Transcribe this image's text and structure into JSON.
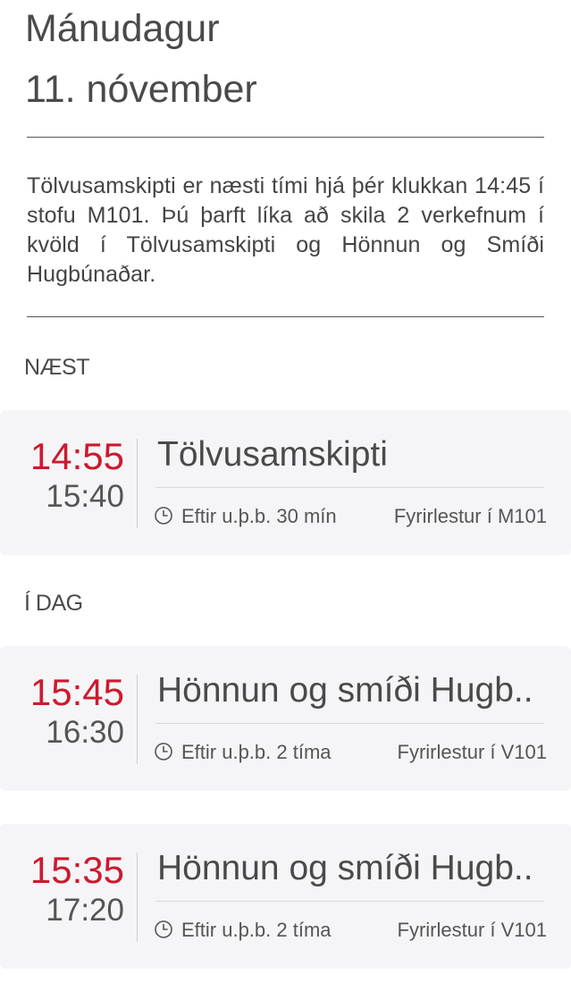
{
  "header": {
    "weekday": "Mánudagur",
    "date": "11. nóvember"
  },
  "summary": "Tölvusamskipti er næsti tími hjá þér klukkan 14:45 í stofu M101. Þú þarft líka að skila 2 verkefnum í kvöld í Tölvusamskipti og Hönnun og Smíði Hugbúnaðar.",
  "sections": {
    "next_label": "NÆST",
    "today_label": "Í DAG"
  },
  "next": [
    {
      "start": "14:55",
      "end": "15:40",
      "title": "Tölvusamskipti",
      "eta": "Eftir u.þ.b. 30 mín",
      "place": "Fyrirlestur í M101"
    }
  ],
  "today": [
    {
      "start": "15:45",
      "end": "16:30",
      "title": "Hönnun og smíði Hugb..",
      "eta": "Eftir u.þ.b. 2 tíma",
      "place": "Fyrirlestur í V101"
    },
    {
      "start": "15:35",
      "end": "17:20",
      "title": "Hönnun og smíði Hugb..",
      "eta": "Eftir u.þ.b. 2 tíma",
      "place": "Fyrirlestur í V101"
    }
  ],
  "icons": {
    "eta_icon": "clock-icon"
  },
  "colors": {
    "accent": "#cc1a2e",
    "card_bg": "#f5f5f7",
    "text": "#4a4a4a"
  }
}
